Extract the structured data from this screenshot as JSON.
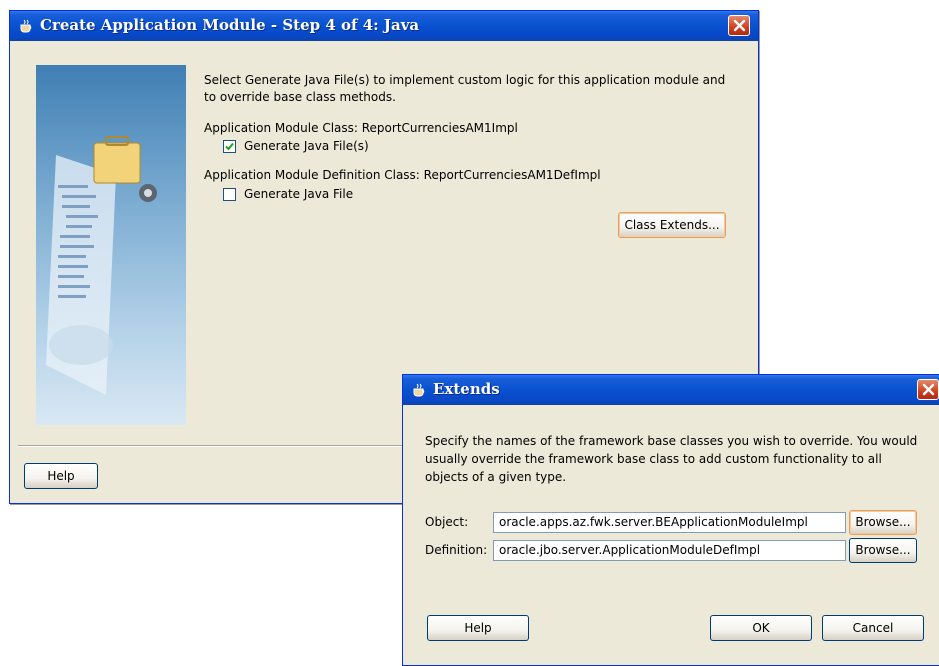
{
  "main_dialog": {
    "title": "Create Application Module - Step 4 of 4: Java",
    "intro_line1": "Select Generate Java File(s) to implement custom logic for this application module and",
    "intro_line2": "to override base class methods.",
    "am_class_label": "Application Module Class: ReportCurrenciesAM1Impl",
    "generate_java_files_label": "Generate Java File(s)",
    "generate_java_files_checked": true,
    "am_def_class_label": "Application Module Definition Class: ReportCurrenciesAM1DefImpl",
    "generate_java_file_label": "Generate Java File",
    "generate_java_file_checked": false,
    "class_extends_button": "Class Extends...",
    "help_button": "Help"
  },
  "extends_dialog": {
    "title": "Extends",
    "description_line1": "Specify the names of the framework base classes you wish to override. You would",
    "description_line2": "usually override the framework base class to add custom functionality to all",
    "description_line3": "objects of a given type.",
    "object_label": "Object:",
    "object_value": "oracle.apps.az.fwk.server.BEApplicationModuleImpl",
    "definition_label": "Definition:",
    "definition_value": "oracle.jbo.server.ApplicationModuleDefImpl",
    "browse_button_1": "Browse...",
    "browse_button_2": "Browse...",
    "help_button": "Help",
    "ok_button": "OK",
    "cancel_button": "Cancel"
  },
  "colors": {
    "titlebar": "#0a53d1",
    "dialog_bg": "#ece9d8",
    "close_button": "#d04020"
  },
  "icons": {
    "title_icon": "java-cup-icon",
    "close": "close-icon",
    "check": "checkmark-icon"
  }
}
